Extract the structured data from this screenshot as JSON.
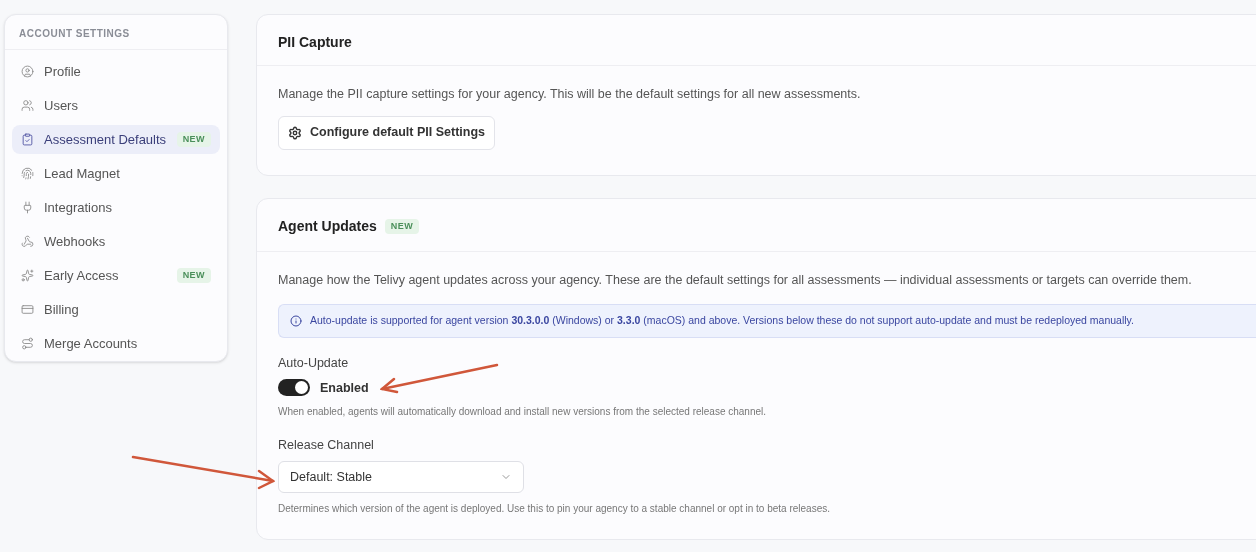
{
  "sidebar": {
    "heading": "ACCOUNT SETTINGS",
    "items": [
      {
        "label": "Profile",
        "selected": false
      },
      {
        "label": "Users",
        "selected": false
      },
      {
        "label": "Assessment Defaults",
        "selected": true,
        "badge": "NEW"
      },
      {
        "label": "Lead Magnet",
        "selected": false
      },
      {
        "label": "Integrations",
        "selected": false
      },
      {
        "label": "Webhooks",
        "selected": false
      },
      {
        "label": "Early Access",
        "selected": false,
        "badge": "NEW"
      },
      {
        "label": "Billing",
        "selected": false
      },
      {
        "label": "Merge Accounts",
        "selected": false
      }
    ]
  },
  "pii_capture": {
    "title": "PII Capture",
    "description": "Manage the PII capture settings for your agency. This will be the default settings for all new assessments.",
    "button": "Configure default PII Settings"
  },
  "agent_updates": {
    "title": "Agent Updates",
    "badge": "NEW",
    "description": "Manage how the Telivy agent updates across your agency. These are the default settings for all assessments — individual assessments or targets can override them.",
    "info": "Auto-update is supported for agent version **30.3.0.0** (Windows) or **3.3.0** (macOS) and above. Versions below these do not support auto-update and must be redeployed manually.",
    "auto_update": {
      "label": "Auto-Update",
      "on": true,
      "state_label": "Enabled",
      "help": "When enabled, agents will automatically download and install new versions from the selected release channel."
    },
    "release_channel": {
      "label": "Release Channel",
      "value": "Default: Stable",
      "help": "Determines which version of the agent is deployed. Use this to pin your agency to a stable channel or opt in to beta releases."
    }
  }
}
